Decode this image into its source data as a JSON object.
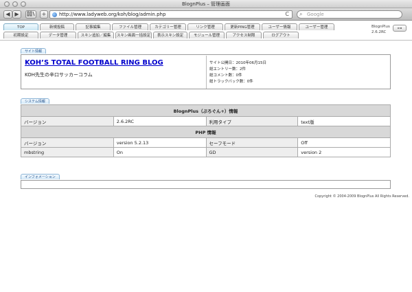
{
  "window": {
    "title": "BlognPlus – 管理画面"
  },
  "browser": {
    "url": "http://www.ladyweb.org/koh/blog/admin.php",
    "search_placeholder": "Google",
    "back_glyph": "◀",
    "forward_glyph": "▶",
    "add_glyph": "+",
    "reload_glyph": "C"
  },
  "nav": {
    "row1": [
      "TOP",
      "新規投稿",
      "記事編集",
      "ファイル管理",
      "カテゴリー管理",
      "リンク管理",
      "更新PING管理",
      "ユーザー情報",
      "ユーザー管理"
    ],
    "row2": [
      "初期設定",
      "データ管理",
      "スキン追加／編集",
      "スキン画面一括設定",
      "表示スキン設定",
      "モジュール管理",
      "アクセス制限",
      "ログアウト"
    ],
    "version_label": "BlognPlus",
    "version_number": "2.6.2RC"
  },
  "site_info": {
    "tab": "サイト情報",
    "title": "KOH’S TOTAL FOOTBALL RING BLOG",
    "subtitle": "KOH先生の辛口サッカーコラム",
    "stats": [
      "サイト公開日：2010年06月15日",
      "総エントリー数：2件",
      "総コメント数：0件",
      "総トラックバック数：0件"
    ]
  },
  "system_info": {
    "tab": "システム情報",
    "blognplus_header": "BlognPlus（ぶろぐん+）情報",
    "blognplus_rows": [
      [
        "バージョン",
        "2.6.2RC",
        "利用タイプ",
        "text版"
      ]
    ],
    "php_header": "PHP 情報",
    "php_rows": [
      [
        "バージョン",
        "version 5.2.13",
        "セーフモード",
        "Off"
      ],
      [
        "mbstring",
        "On",
        "GD",
        "version 2"
      ]
    ]
  },
  "information": {
    "tab": "インフォメーション"
  },
  "footer": {
    "copyright": "Copyright © 2004-2009 BlognPlus All Rights Reserved."
  }
}
